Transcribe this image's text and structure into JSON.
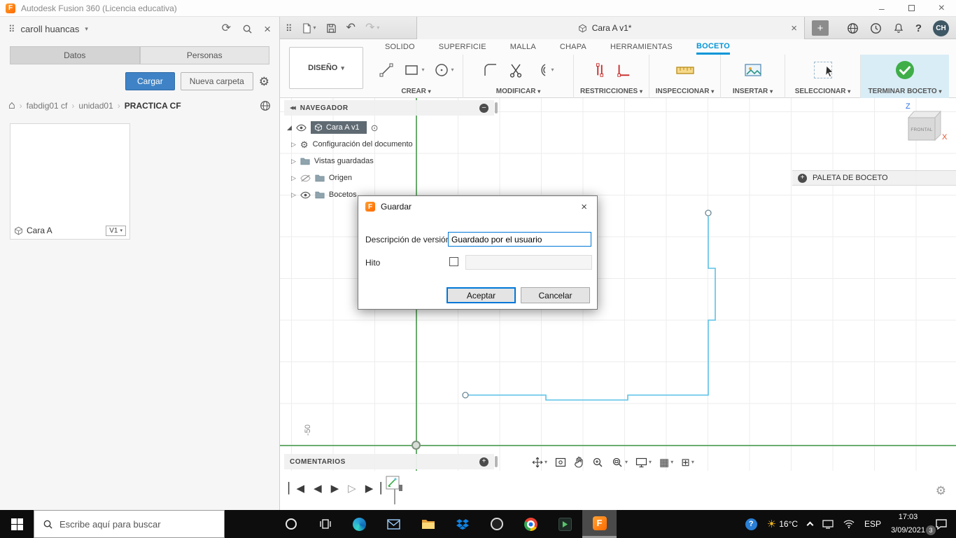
{
  "window": {
    "title": "Autodesk Fusion 360 (Licencia educativa)"
  },
  "left_panel": {
    "user_name": "caroll huancas",
    "tabs": [
      {
        "label": "Datos",
        "active": true
      },
      {
        "label": "Personas",
        "active": false
      }
    ],
    "upload_button": "Cargar",
    "new_folder_button": "Nueva carpeta",
    "breadcrumb": {
      "items": [
        "fabdig01 cf",
        "unidad01",
        "PRACTICA CF"
      ]
    },
    "card": {
      "name": "Cara A",
      "version": "V1"
    }
  },
  "document_bar": {
    "tab_title": "Cara A v1*",
    "avatar_initials": "CH"
  },
  "ribbon": {
    "workspace": "DISEÑO",
    "tabs": [
      "SOLIDO",
      "SUPERFICIE",
      "MALLA",
      "CHAPA",
      "HERRAMIENTAS",
      "BOCETO"
    ],
    "active_tab": "BOCETO",
    "groups": [
      {
        "label": "CREAR"
      },
      {
        "label": "MODIFICAR"
      },
      {
        "label": "RESTRICCIONES"
      },
      {
        "label": "INSPECCIONAR"
      },
      {
        "label": "INSERTAR"
      },
      {
        "label": "SELECCIONAR"
      },
      {
        "label": "TERMINAR BOCETO"
      }
    ]
  },
  "navigator": {
    "title": "NAVEGADOR",
    "items": [
      {
        "label": "Cara A v1",
        "selected": true
      },
      {
        "label": "Configuración del documento"
      },
      {
        "label": "Vistas guardadas"
      },
      {
        "label": "Origen"
      },
      {
        "label": "Bocetos"
      }
    ]
  },
  "viewcube": {
    "face": "FRONTAL",
    "axis_z": "Z",
    "axis_x": "X"
  },
  "sketch_palette": {
    "title": "PALETA DE BOCETO"
  },
  "comments_panel": {
    "title": "COMENTARIOS"
  },
  "canvas": {
    "axis_tick_label": "-50"
  },
  "dialog": {
    "title": "Guardar",
    "version_label": "Descripción de versión",
    "version_value": "Guardado por el usuario",
    "milestone_label": "Hito",
    "milestone_value": "",
    "ok_button": "Aceptar",
    "cancel_button": "Cancelar"
  },
  "taskbar": {
    "search_placeholder": "Escribe aquí para buscar",
    "temperature": "16°C",
    "language": "ESP",
    "time": "17:03",
    "date": "3/09/2021",
    "notification_count": "3"
  },
  "colors": {
    "accent_blue": "#0078d7",
    "ribbon_tab_active": "#0696d7",
    "fusion_orange": "#ff6f00",
    "sketch_line": "#5bc2e7",
    "axis_green": "#6aac6e",
    "finish_green": "#3fae49"
  }
}
